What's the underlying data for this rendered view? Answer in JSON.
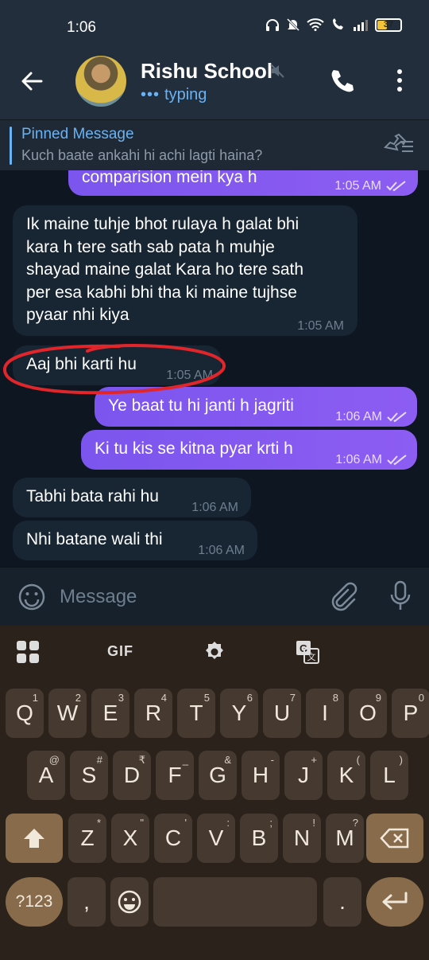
{
  "status": {
    "time": "1:06",
    "battery": "37"
  },
  "header": {
    "title": "Rishu School",
    "subtitle": "typing"
  },
  "pinned": {
    "label": "Pinned Message",
    "text": "Kuch baate ankahi hi achi lagti haina?"
  },
  "messages": [
    {
      "dir": "out",
      "text": "comparision mein kya h",
      "time": "1:05 AM"
    },
    {
      "dir": "in",
      "lines": [
        "Ik maine tuhje bhot rulaya h galat bhi",
        "kara h tere sath sab pata h muhje",
        "shayad maine galat Kara ho tere sath",
        "per esa kabhi bhi tha ki maine tujhse",
        "pyaar nhi kiya"
      ],
      "time": "1:05 AM"
    },
    {
      "dir": "in",
      "text": "Aaj bhi karti hu",
      "time": "1:05 AM"
    },
    {
      "dir": "out",
      "text": "Ye baat tu hi janti h jagriti",
      "time": "1:06 AM"
    },
    {
      "dir": "out",
      "text": "Ki tu kis se kitna pyar krti h",
      "time": "1:06 AM"
    },
    {
      "dir": "in",
      "text": "Tabhi bata rahi hu",
      "time": "1:06 AM"
    },
    {
      "dir": "in",
      "text": "Nhi batane wali thi",
      "time": "1:06 AM"
    }
  ],
  "composer": {
    "placeholder": "Message"
  },
  "keyboard": {
    "toolbar": {
      "gif": "GIF"
    },
    "row1": [
      {
        "k": "Q",
        "a": "1"
      },
      {
        "k": "W",
        "a": "2"
      },
      {
        "k": "E",
        "a": "3"
      },
      {
        "k": "R",
        "a": "4"
      },
      {
        "k": "T",
        "a": "5"
      },
      {
        "k": "Y",
        "a": "6"
      },
      {
        "k": "U",
        "a": "7"
      },
      {
        "k": "I",
        "a": "8"
      },
      {
        "k": "O",
        "a": "9"
      },
      {
        "k": "P",
        "a": "0"
      }
    ],
    "row2": [
      {
        "k": "A",
        "a": "@"
      },
      {
        "k": "S",
        "a": "#"
      },
      {
        "k": "D",
        "a": "₹"
      },
      {
        "k": "F",
        "a": "_"
      },
      {
        "k": "G",
        "a": "&"
      },
      {
        "k": "H",
        "a": "-"
      },
      {
        "k": "J",
        "a": "+"
      },
      {
        "k": "K",
        "a": "("
      },
      {
        "k": "L",
        "a": ")"
      }
    ],
    "row3": [
      {
        "k": "Z",
        "a": "*"
      },
      {
        "k": "X",
        "a": "\""
      },
      {
        "k": "C",
        "a": "'"
      },
      {
        "k": "V",
        "a": ":"
      },
      {
        "k": "B",
        "a": ";"
      },
      {
        "k": "N",
        "a": "!"
      },
      {
        "k": "M",
        "a": "?"
      }
    ],
    "symbols_label": "?123",
    "comma": ",",
    "period": "."
  },
  "colors": {
    "accent": "#6ab2f2",
    "outgoing": "#7b55ee",
    "incoming": "#182533",
    "annotation": "#e0262b"
  }
}
